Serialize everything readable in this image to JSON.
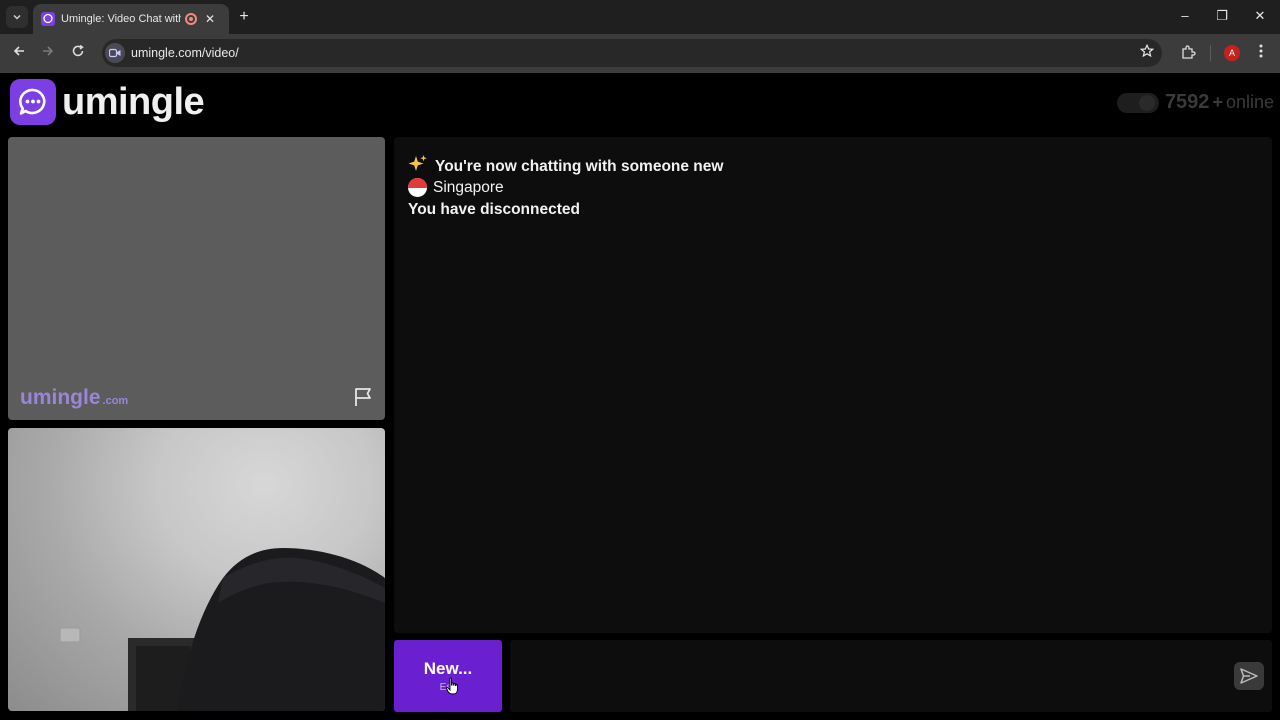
{
  "browser": {
    "tab_title": "Umingle: Video Chat with Strangers",
    "tab_close": "✕",
    "new_tab": "+",
    "url": "umingle.com/video/",
    "profile_initial": "A",
    "window_controls": {
      "minimize": "–",
      "maximize": "❐",
      "close": "✕"
    }
  },
  "site": {
    "logo_text": "umingle",
    "online_count": "7592",
    "online_plus": "+",
    "online_label": "online",
    "brand_color": "#7b3fe4"
  },
  "remote_video": {
    "watermark": "umingle",
    "watermark_domain": ".com"
  },
  "chat": {
    "messages": [
      {
        "icon": "sparkle-icon",
        "text": "You're now chatting with someone new"
      },
      {
        "icon": "singapore-flag-icon",
        "text": "Singapore"
      },
      {
        "icon": "",
        "text": "You have disconnected"
      }
    ]
  },
  "controls": {
    "new_label": "New...",
    "new_hint": "Esc",
    "new_button_color": "#6a1fd0"
  }
}
